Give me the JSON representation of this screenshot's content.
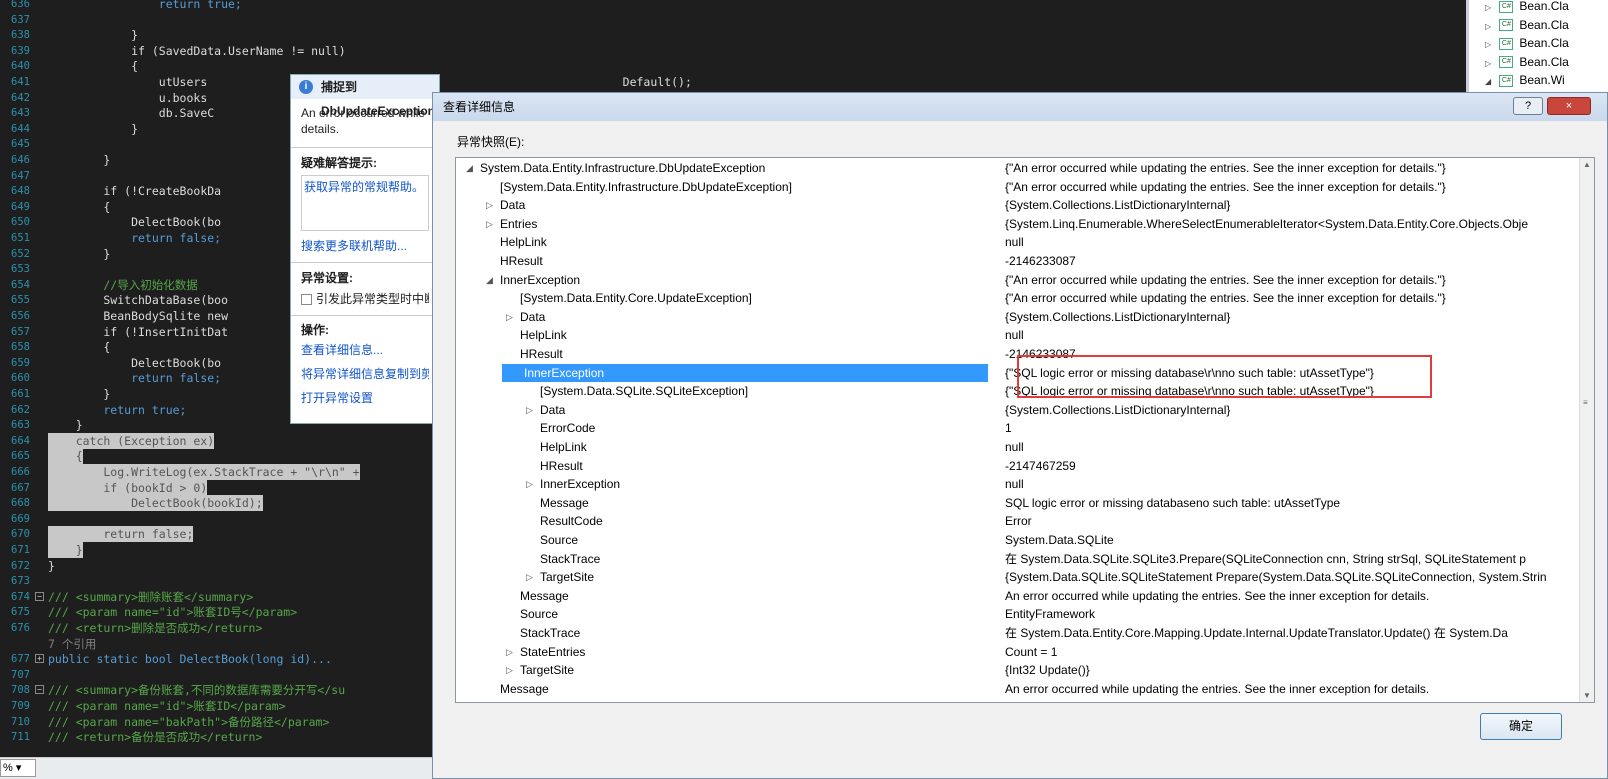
{
  "editor": {
    "lines": [
      {
        "n": "636",
        "t": "                return true;"
      },
      {
        "n": "637",
        "t": ""
      },
      {
        "n": "638",
        "t": "            }"
      },
      {
        "n": "639",
        "t": "            if (SavedData.UserName != null)"
      },
      {
        "n": "640",
        "t": "            {"
      },
      {
        "n": "641",
        "t": "                utUsers                                                            Default();"
      },
      {
        "n": "642",
        "t": "                u.books"
      },
      {
        "n": "643",
        "t": "                db.SaveC"
      },
      {
        "n": "644",
        "t": "            }"
      },
      {
        "n": "645",
        "t": ""
      },
      {
        "n": "646",
        "t": "        }"
      },
      {
        "n": "647",
        "t": ""
      },
      {
        "n": "648",
        "t": "        if (!CreateBookDa"
      },
      {
        "n": "649",
        "t": "        {"
      },
      {
        "n": "650",
        "t": "            DelectBook(bo"
      },
      {
        "n": "651",
        "t": "            return false;"
      },
      {
        "n": "652",
        "t": "        }"
      },
      {
        "n": "653",
        "t": ""
      },
      {
        "n": "654",
        "t": "        //导入初始化数据"
      },
      {
        "n": "655",
        "t": "        SwitchDataBase(boo"
      },
      {
        "n": "656",
        "t": "        BeanBodySqlite new"
      },
      {
        "n": "657",
        "t": "        if (!InsertInitDat"
      },
      {
        "n": "658",
        "t": "        {"
      },
      {
        "n": "659",
        "t": "            DelectBook(bo"
      },
      {
        "n": "660",
        "t": "            return false;"
      },
      {
        "n": "661",
        "t": "        }"
      },
      {
        "n": "662",
        "t": "        return true;"
      },
      {
        "n": "663",
        "t": "    }"
      },
      {
        "n": "664",
        "t": "    catch (Exception ex)"
      },
      {
        "n": "665",
        "t": "    {"
      },
      {
        "n": "666",
        "t": "        Log.WriteLog(ex.StackTrace + \"\\r\\n\" +"
      },
      {
        "n": "667",
        "t": "        if (bookId > 0)"
      },
      {
        "n": "668",
        "t": "            DelectBook(bookId);"
      },
      {
        "n": "669",
        "t": ""
      },
      {
        "n": "670",
        "t": "        return false;"
      },
      {
        "n": "671",
        "t": "    }"
      },
      {
        "n": "672",
        "t": "}"
      },
      {
        "n": "673",
        "t": ""
      },
      {
        "n": "674",
        "t": "/// <summary>删除账套</summary>"
      },
      {
        "n": "675",
        "t": "/// <param name=\"id\">账套ID号</param>"
      },
      {
        "n": "676",
        "t": "/// <return>删除是否成功</return>"
      },
      {
        "n": "",
        "t": "7 个引用"
      },
      {
        "n": "677",
        "t": "public static bool DelectBook(long id)..."
      },
      {
        "n": "707",
        "t": ""
      },
      {
        "n": "708",
        "t": "/// <summary>备份账套,不同的数据库需要分开写</su"
      },
      {
        "n": "709",
        "t": "/// <param name=\"id\">账套ID</param>"
      },
      {
        "n": "710",
        "t": "/// <param name=\"bakPath\">备份路径</param>"
      },
      {
        "n": "711",
        "t": "/// <return>备份是否成功</return>"
      }
    ],
    "zoom": "%"
  },
  "solution_tree": {
    "items": [
      "Bean.Cla",
      "Bean.Cla",
      "Bean.Cla",
      "Bean.Cla",
      "Bean.Wi"
    ]
  },
  "exception_popup": {
    "title": "捕捉到 DbUpdateException",
    "message": "An error occurred while details.",
    "troubleshoot_header": "疑难解答提示:",
    "troubleshoot_link": "获取异常的常规帮助。",
    "more_help_link": "搜索更多联机帮助...",
    "settings_header": "异常设置:",
    "checkbox_label": "引发此异常类型时中断",
    "actions_header": "操作:",
    "action_view_detail": "查看详细信息...",
    "action_copy": "将异常详细信息复制到剪贴板",
    "action_settings": "打开异常设置"
  },
  "dialog": {
    "title": "查看详细信息",
    "help_button": "?",
    "close_button": "×",
    "snapshot_label": "异常快照(E):",
    "ok_button": "确定",
    "rows": [
      {
        "d": 0,
        "e": "open",
        "n": "System.Data.Entity.Infrastructure.DbUpdateException",
        "v": "{\"An error occurred while updating the entries. See the inner exception for details.\"}"
      },
      {
        "d": 1,
        "e": "",
        "n": "[System.Data.Entity.Infrastructure.DbUpdateException]",
        "v": "{\"An error occurred while updating the entries. See the inner exception for details.\"}"
      },
      {
        "d": 1,
        "e": "closed",
        "n": "Data",
        "v": "{System.Collections.ListDictionaryInternal}"
      },
      {
        "d": 1,
        "e": "closed",
        "n": "Entries",
        "v": "{System.Linq.Enumerable.WhereSelectEnumerableIterator<System.Data.Entity.Core.Objects.Obje"
      },
      {
        "d": 1,
        "e": "",
        "n": "HelpLink",
        "v": "null"
      },
      {
        "d": 1,
        "e": "",
        "n": "HResult",
        "v": "-2146233087"
      },
      {
        "d": 1,
        "e": "open",
        "n": "InnerException",
        "v": "{\"An error occurred while updating the entries. See the inner exception for details.\"}"
      },
      {
        "d": 2,
        "e": "",
        "n": "[System.Data.Entity.Core.UpdateException]",
        "v": "{\"An error occurred while updating the entries. See the inner exception for details.\"}"
      },
      {
        "d": 2,
        "e": "closed",
        "n": "Data",
        "v": "{System.Collections.ListDictionaryInternal}"
      },
      {
        "d": 2,
        "e": "",
        "n": "HelpLink",
        "v": "null"
      },
      {
        "d": 2,
        "e": "",
        "n": "HResult",
        "v": "-2146233087"
      },
      {
        "d": 2,
        "e": "open",
        "n": "InnerException",
        "v": "{\"SQL logic error or missing database\\r\\nno such table: utAssetType\"}",
        "sel": true
      },
      {
        "d": 3,
        "e": "",
        "n": "[System.Data.SQLite.SQLiteException]",
        "v": "{\"SQL logic error or missing database\\r\\nno such table: utAssetType\"}"
      },
      {
        "d": 3,
        "e": "closed",
        "n": "Data",
        "v": "{System.Collections.ListDictionaryInternal}"
      },
      {
        "d": 3,
        "e": "",
        "n": "ErrorCode",
        "v": "1"
      },
      {
        "d": 3,
        "e": "",
        "n": "HelpLink",
        "v": "null"
      },
      {
        "d": 3,
        "e": "",
        "n": "HResult",
        "v": "-2147467259"
      },
      {
        "d": 3,
        "e": "closed",
        "n": "InnerException",
        "v": "null"
      },
      {
        "d": 3,
        "e": "",
        "n": "Message",
        "v": "SQL logic error or missing databaseno such table: utAssetType"
      },
      {
        "d": 3,
        "e": "",
        "n": "ResultCode",
        "v": "Error"
      },
      {
        "d": 3,
        "e": "",
        "n": "Source",
        "v": "System.Data.SQLite"
      },
      {
        "d": 3,
        "e": "",
        "n": "StackTrace",
        "v": "   在 System.Data.SQLite.SQLite3.Prepare(SQLiteConnection cnn, String strSql, SQLiteStatement p"
      },
      {
        "d": 3,
        "e": "closed",
        "n": "TargetSite",
        "v": "{System.Data.SQLite.SQLiteStatement Prepare(System.Data.SQLite.SQLiteConnection, System.Strin"
      },
      {
        "d": 2,
        "e": "",
        "n": "Message",
        "v": "An error occurred while updating the entries. See the inner exception for details."
      },
      {
        "d": 2,
        "e": "",
        "n": "Source",
        "v": "EntityFramework"
      },
      {
        "d": 2,
        "e": "",
        "n": "StackTrace",
        "v": "   在 System.Data.Entity.Core.Mapping.Update.Internal.UpdateTranslator.Update()   在 System.Da"
      },
      {
        "d": 2,
        "e": "closed",
        "n": "StateEntries",
        "v": "Count = 1"
      },
      {
        "d": 2,
        "e": "closed",
        "n": "TargetSite",
        "v": "{Int32 Update()}"
      },
      {
        "d": 1,
        "e": "",
        "n": "Message",
        "v": "An error occurred while updating the entries. See the inner exception for details."
      }
    ]
  }
}
